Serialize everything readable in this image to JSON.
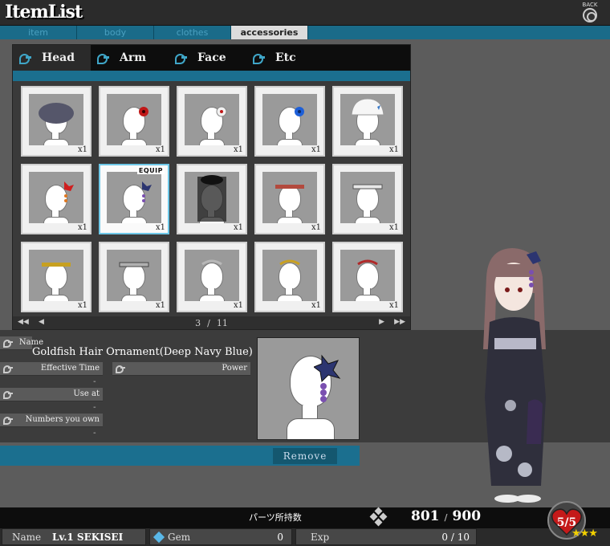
{
  "header": {
    "logo": "ItemList",
    "back_label": "BACK",
    "categories": [
      "item",
      "body",
      "clothes",
      "accessories"
    ]
  },
  "subtabs": [
    "Head",
    "Arm",
    "Face",
    "Etc"
  ],
  "items": [
    {
      "qty": "x1",
      "acc": "cap-gray"
    },
    {
      "qty": "x1",
      "acc": "flower-red"
    },
    {
      "qty": "x1",
      "acc": "flower-white"
    },
    {
      "qty": "x1",
      "acc": "flower-blue"
    },
    {
      "qty": "x1",
      "acc": "hat-white"
    },
    {
      "qty": "x1",
      "acc": "goldfish-red"
    },
    {
      "qty": "x1",
      "acc": "goldfish-navy",
      "equip": "EQUIP"
    },
    {
      "qty": "x1",
      "acc": "veil-black"
    },
    {
      "qty": "x1",
      "acc": "band-red"
    },
    {
      "qty": "x1",
      "acc": "band-white"
    },
    {
      "qty": "x1",
      "acc": "band-gold"
    },
    {
      "qty": "x1",
      "acc": "band-silver"
    },
    {
      "qty": "x1",
      "acc": "tiara-silver"
    },
    {
      "qty": "x1",
      "acc": "tiara-gold"
    },
    {
      "qty": "x1",
      "acc": "tiara-red"
    }
  ],
  "pager": {
    "current": "3",
    "sep": "/",
    "total": "11"
  },
  "info": {
    "name_label": "Name",
    "name_value": "Goldfish Hair Ornament(Deep Navy Blue)",
    "effective_time_label": "Effective Time",
    "effective_time_value": "-",
    "power_label": "Power",
    "use_at_label": "Use at",
    "use_at_value": "-",
    "numbers_label": "Numbers you own",
    "numbers_value": "-"
  },
  "remove_label": "Remove",
  "parts": {
    "label": "パーツ所持数",
    "owned": "801",
    "sep": "/",
    "max": "900"
  },
  "status": {
    "name_key": "Name",
    "name_value": "Lv.1 SEKISEI",
    "gem_key": "Gem",
    "gem_value": "0",
    "exp_key": "Exp",
    "exp_value": "0 / 10",
    "hearts": "5/5",
    "stars": "★★★"
  },
  "colors": {
    "accent": "#1b6f8f",
    "selected_border": "#6ec8e8",
    "heart": "#c41a1a",
    "star": "#f2d000"
  }
}
